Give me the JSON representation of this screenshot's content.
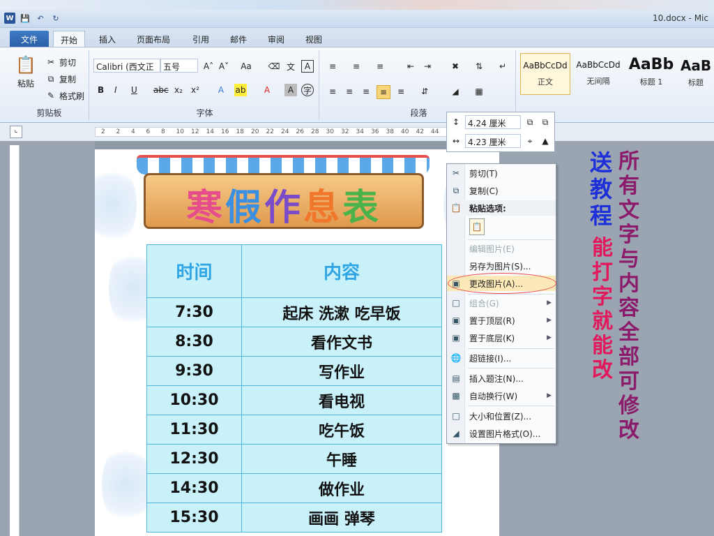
{
  "window": {
    "title": "10.docx - Mic",
    "qat_icons": [
      "word-logo",
      "save-icon",
      "undo-icon",
      "redo-icon"
    ]
  },
  "tabs": [
    "文件",
    "开始",
    "插入",
    "页面布局",
    "引用",
    "邮件",
    "审阅",
    "视图"
  ],
  "ribbon": {
    "clipboard": {
      "label": "剪贴板",
      "paste": "粘贴",
      "cut": "剪切",
      "copy": "复制",
      "format_painter": "格式刷"
    },
    "font": {
      "label": "字体",
      "font_name": "Calibri (西文正",
      "font_size": "五号",
      "bold": "B",
      "italic": "I",
      "underline": "U",
      "strike": "abc",
      "sub": "x₂",
      "sup": "x²"
    },
    "paragraph": {
      "label": "段落"
    },
    "styles": [
      {
        "preview": "AaBbCcDd",
        "name": "正文"
      },
      {
        "preview": "AaBbCcDd",
        "name": "无间隔"
      },
      {
        "preview": "AaBb",
        "name": "标题 1"
      },
      {
        "preview": "AaB",
        "name": "标题"
      }
    ]
  },
  "ruler": {
    "ticks": [
      "2",
      "2",
      "4",
      "6",
      "8",
      "10",
      "12",
      "14",
      "16",
      "18",
      "20",
      "22",
      "24",
      "26",
      "28",
      "30",
      "32",
      "34",
      "36",
      "38",
      "40",
      "42",
      "44"
    ]
  },
  "mini_toolbar": {
    "height_value": "4.24 厘米",
    "width_value": "4.23 厘米"
  },
  "document": {
    "title_chars": [
      "寒",
      "假",
      "作",
      "息",
      "表"
    ],
    "table_headers": [
      "时间",
      "内容"
    ],
    "rows": [
      {
        "time": "7:30",
        "content": "起床 洗漱 吃早饭"
      },
      {
        "time": "8:30",
        "content": "看作文书"
      },
      {
        "time": "9:30",
        "content": "写作业"
      },
      {
        "time": "10:30",
        "content": "看电视"
      },
      {
        "time": "11:30",
        "content": "吃午饭"
      },
      {
        "time": "12:30",
        "content": "午睡"
      },
      {
        "time": "14:30",
        "content": "做作业"
      },
      {
        "time": "15:30",
        "content": "画画 弹琴"
      }
    ]
  },
  "context_menu": [
    {
      "label": "剪切(T)",
      "icon": "scissors-icon"
    },
    {
      "label": "复制(C)",
      "icon": "copy-icon"
    },
    {
      "label": "粘贴选项:",
      "icon": "paste-icon",
      "header": true
    },
    {
      "label": "",
      "icon": "paste-option-icon",
      "paste_option": true
    },
    {
      "label": "编辑图片(E)",
      "icon": "",
      "disabled": true
    },
    {
      "label": "另存为图片(S)...",
      "icon": ""
    },
    {
      "label": "更改图片(A)...",
      "icon": "change-picture-icon",
      "highlight": true
    },
    {
      "label": "组合(G)",
      "icon": "group-icon",
      "disabled": true,
      "submenu": true
    },
    {
      "label": "置于顶层(R)",
      "icon": "bring-front-icon",
      "submenu": true
    },
    {
      "label": "置于底层(K)",
      "icon": "send-back-icon",
      "submenu": true
    },
    {
      "label": "超链接(I)...",
      "icon": "hyperlink-icon"
    },
    {
      "label": "插入题注(N)...",
      "icon": "caption-icon"
    },
    {
      "label": "自动换行(W)",
      "icon": "wrap-icon",
      "submenu": true
    },
    {
      "label": "大小和位置(Z)...",
      "icon": "size-icon"
    },
    {
      "label": "设置图片格式(O)...",
      "icon": "format-picture-icon"
    }
  ],
  "promo": {
    "col1": "送教程",
    "col2": "能打字就能改",
    "col3": "所有文字与内容全部可修改"
  },
  "colors": {
    "accent": "#2a5699",
    "highlight": "#fde9b8",
    "table_bg": "#c9f1fa"
  }
}
